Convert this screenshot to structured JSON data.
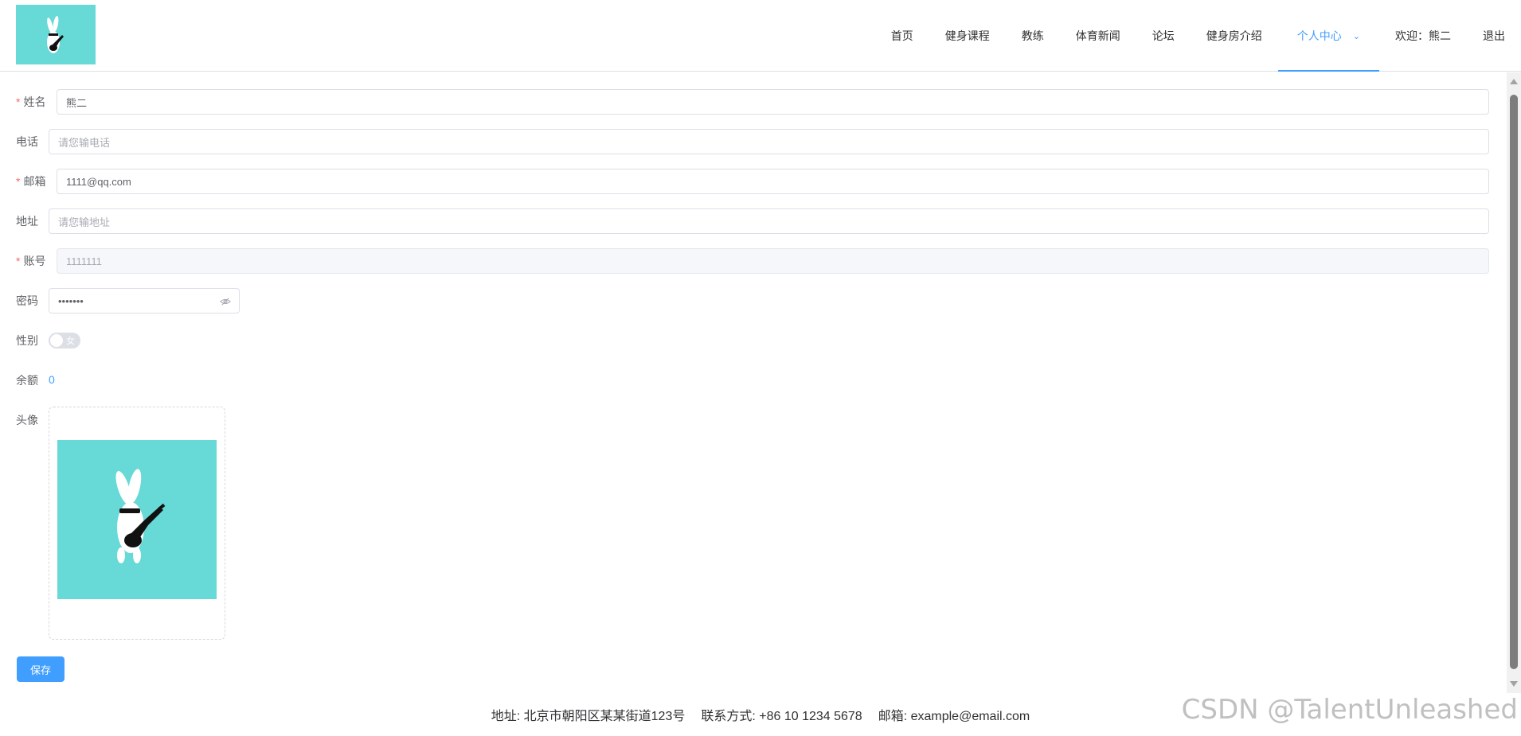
{
  "nav": {
    "items": [
      "首页",
      "健身课程",
      "教练",
      "体育新闻",
      "论坛",
      "健身房介绍"
    ],
    "active": "个人中心",
    "welcome": "欢迎：熊二",
    "logout": "退出"
  },
  "form": {
    "name_label": "姓名",
    "name_value": "熊二",
    "phone_label": "电话",
    "phone_placeholder": "请您输电话",
    "email_label": "邮箱",
    "email_value": "1111@qq.com",
    "address_label": "地址",
    "address_placeholder": "请您输地址",
    "account_label": "账号",
    "account_value": "1111111",
    "password_label": "密码",
    "password_value": "•••••••",
    "gender_label": "性别",
    "gender_value": "女",
    "balance_label": "余额",
    "balance_value": "0",
    "avatar_label": "头像",
    "save_label": "保存"
  },
  "footer": {
    "address": "地址: 北京市朝阳区某某街道123号",
    "contact": "联系方式: +86 10 1234 5678",
    "email": "邮箱: example@email.com"
  },
  "watermark": "CSDN @TalentUnleashed",
  "colors": {
    "accent": "#409eff",
    "required": "#f56c6c",
    "logo_bg": "#67d9d6"
  }
}
